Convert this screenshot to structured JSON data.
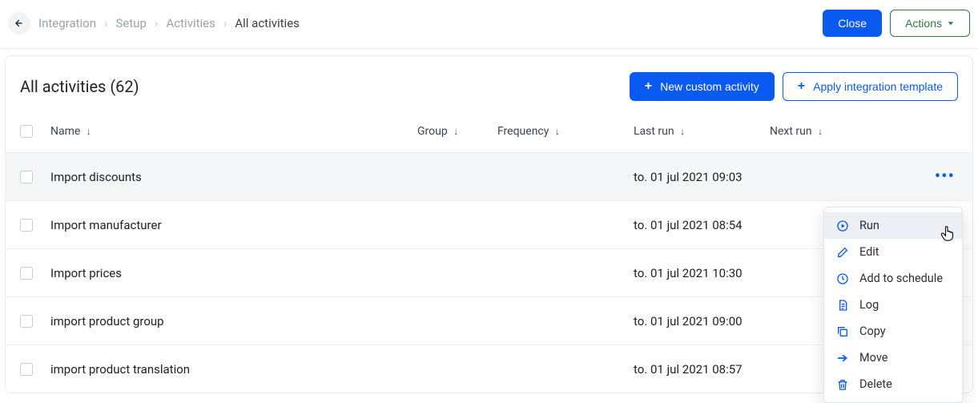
{
  "breadcrumb": {
    "items": [
      "Integration",
      "Setup",
      "Activities"
    ],
    "current": "All activities"
  },
  "topbar": {
    "close_label": "Close",
    "actions_label": "Actions"
  },
  "panel": {
    "title": "All activities (62)",
    "new_activity_label": "New custom activity",
    "apply_template_label": "Apply integration template"
  },
  "columns": {
    "name": "Name",
    "group": "Group",
    "frequency": "Frequency",
    "last_run": "Last run",
    "next_run": "Next run"
  },
  "rows": [
    {
      "name": "Import discounts",
      "last_run": "to. 01 jul 2021 09:03",
      "hovered": true
    },
    {
      "name": "Import manufacturer",
      "last_run": "to. 01 jul 2021 08:54"
    },
    {
      "name": "Import prices",
      "last_run": "to. 01 jul 2021 10:30"
    },
    {
      "name": "import product group",
      "last_run": "to. 01 jul 2021 09:00"
    },
    {
      "name": "import product translation",
      "last_run": "to. 01 jul 2021 08:57"
    }
  ],
  "context_menu": {
    "items": [
      {
        "key": "run",
        "label": "Run",
        "icon": "play-icon",
        "highlight": true
      },
      {
        "key": "edit",
        "label": "Edit",
        "icon": "edit-icon"
      },
      {
        "key": "schedule",
        "label": "Add to schedule",
        "icon": "clock-icon"
      },
      {
        "key": "log",
        "label": "Log",
        "icon": "log-icon"
      },
      {
        "key": "copy",
        "label": "Copy",
        "icon": "copy-icon"
      },
      {
        "key": "move",
        "label": "Move",
        "icon": "move-icon"
      },
      {
        "key": "delete",
        "label": "Delete",
        "icon": "trash-icon"
      }
    ]
  }
}
